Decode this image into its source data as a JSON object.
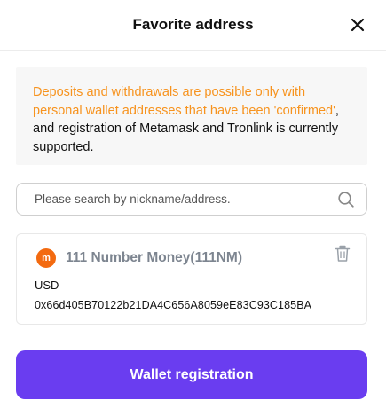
{
  "header": {
    "title": "Favorite address",
    "close_icon": "close-icon"
  },
  "notice": {
    "part1": "Deposits and withdrawals are possible only with personal wallet addresses that have been ",
    "part2": "'confirmed'",
    "part3": ", and registration of Metamask and Tronlink is currently supported.",
    "accent_color": "#f7931e"
  },
  "search": {
    "placeholder": "Please search by nickname/address.",
    "value": "",
    "icon": "search-icon"
  },
  "wallets": [
    {
      "logo_text": "m",
      "name": "111 Number Money(111NM)",
      "network": "USD",
      "address": "0x66d405B70122b21DA4C656A8059eE83C93C185BA",
      "delete_icon": "trash-icon"
    }
  ],
  "footer": {
    "register_label": "Wallet registration",
    "button_color": "#6a3df0"
  }
}
